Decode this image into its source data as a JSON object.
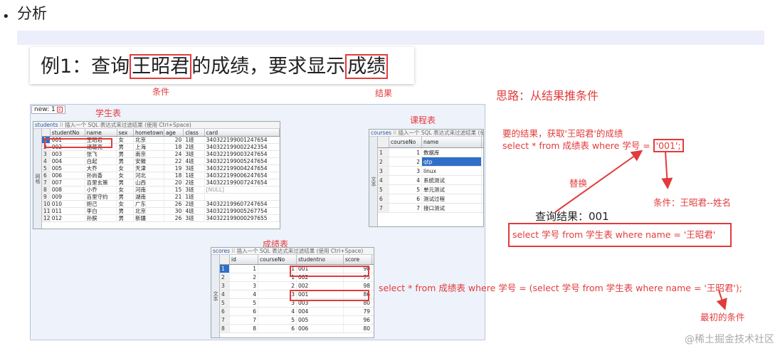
{
  "section": {
    "bullet": "•",
    "title": "分析"
  },
  "example": {
    "prefix": "例1：查询",
    "name": "王昭君",
    "middle": "的成绩，要求显示",
    "target": "成绩"
  },
  "labels": {
    "condition": "条件",
    "result": "结果",
    "thought": "思路：从结果推条件",
    "students": "学生表",
    "courses": "课程表",
    "scores": "成绩表"
  },
  "tab": {
    "label": "new: 1",
    "close": "x"
  },
  "hint": "插入一个 SQL 表达式来过滤结果 (使用 Ctrl+Space)",
  "side_label": "网格",
  "side_label2": "文本",
  "students": {
    "table": "students",
    "columns": [
      "studentNo",
      "name",
      "sex",
      "hometown",
      "age",
      "class",
      "card"
    ],
    "rows": [
      [
        "1",
        "001",
        "王昭君",
        "女",
        "北京",
        "20",
        "1班",
        "340322199001247654"
      ],
      [
        "2",
        "002",
        "诸葛亮",
        "男",
        "上海",
        "18",
        "2班",
        "340322199002242354"
      ],
      [
        "3",
        "003",
        "张飞",
        "男",
        "南京",
        "24",
        "3班",
        "340322199003247654"
      ],
      [
        "4",
        "004",
        "白起",
        "男",
        "安徽",
        "22",
        "4班",
        "340322199005247654"
      ],
      [
        "5",
        "005",
        "大乔",
        "女",
        "天津",
        "19",
        "3班",
        "340322199004247654"
      ],
      [
        "6",
        "006",
        "孙尚香",
        "女",
        "河北",
        "18",
        "1班",
        "340322199006247654"
      ],
      [
        "7",
        "007",
        "百里玄策",
        "男",
        "山西",
        "20",
        "2班",
        "340322199007247654"
      ],
      [
        "8",
        "008",
        "小乔",
        "女",
        "河南",
        "15",
        "3班",
        "[NULL]"
      ],
      [
        "9",
        "009",
        "百里守约",
        "男",
        "湖南",
        "21",
        "1班",
        ""
      ],
      [
        "10",
        "010",
        "妲己",
        "女",
        "广东",
        "26",
        "2班",
        "340322199607247654"
      ],
      [
        "11",
        "011",
        "李白",
        "男",
        "北京",
        "30",
        "4班",
        "340322199005267754"
      ],
      [
        "12",
        "012",
        "孙膑",
        "男",
        "新疆",
        "26",
        "3班",
        "340322199000297655"
      ]
    ]
  },
  "courses": {
    "table": "courses",
    "columns": [
      "courseNo",
      "name"
    ],
    "rows": [
      [
        "1",
        "1",
        "数据库"
      ],
      [
        "2",
        "2",
        "qtp"
      ],
      [
        "3",
        "3",
        "linux"
      ],
      [
        "4",
        "4",
        "系统测试"
      ],
      [
        "5",
        "5",
        "单元测试"
      ],
      [
        "6",
        "6",
        "测试过程"
      ],
      [
        "7",
        "7",
        "接口测试"
      ]
    ]
  },
  "scores": {
    "table": "scores",
    "columns": [
      "id",
      "courseNo",
      "studentno",
      "score"
    ],
    "rows": [
      [
        "1",
        "1",
        "1",
        "001",
        "90"
      ],
      [
        "2",
        "2",
        "1",
        "002",
        "75"
      ],
      [
        "3",
        "3",
        "2",
        "002",
        "98"
      ],
      [
        "4",
        "4",
        "3",
        "001",
        "86"
      ],
      [
        "5",
        "5",
        "3",
        "003",
        "80"
      ],
      [
        "6",
        "6",
        "4",
        "004",
        "79"
      ],
      [
        "7",
        "7",
        "5",
        "005",
        "96"
      ],
      [
        "8",
        "8",
        "6",
        "006",
        "80"
      ]
    ]
  },
  "annotations": {
    "goal_line1": "要的结果，获取'王昭君'的成绩",
    "goal_sql": "select * from 成绩表 where 学号 = ",
    "goal_value": "'001';",
    "replace": "替换",
    "cond": "条件：王昭君--姓名",
    "query_result": "查询结果：001",
    "inner_sql": "select 学号  from  学生表  where  name = '王昭君'",
    "full_sql": "select * from 成绩表 where 学号 = (select 学号  from  学生表  where  name = '王昭君');",
    "initial": "最初的条件"
  },
  "watermark": "@稀土掘金技术社区",
  "colors": {
    "accent_red": "#e23b3b",
    "selection_blue": "#2f6fc9"
  }
}
